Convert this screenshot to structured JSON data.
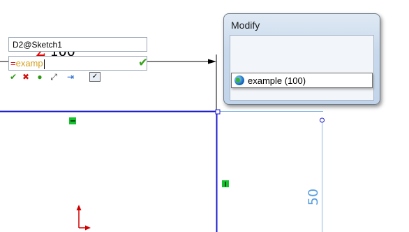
{
  "sketch": {
    "dimension_label": {
      "symbol": "Σ",
      "value": "100"
    },
    "vertical_dimension": "50",
    "colors": {
      "sketch_line": "#1c1ccc",
      "dimension_line": "#000000",
      "extension_line": "#5a9fe0",
      "relation": "#14c22e",
      "origin": "#d00000"
    },
    "icons": [
      "horizontal-relation-icon",
      "vertical-relation-icon",
      "origin-arrow-icon"
    ]
  },
  "modify_dialog": {
    "title": "Modify",
    "dimension_name": "D2@Sketch1",
    "value_prefix": "=",
    "value_text": "examp",
    "ok_icon": "check-icon",
    "toolbar_icons": [
      "confirm-icon",
      "cancel-icon",
      "rebuild-icon",
      "reverse-icon",
      "mark-icon",
      "toggle-icon"
    ]
  },
  "autocomplete": {
    "items": [
      {
        "icon": "globe-icon",
        "label": "example (100)"
      }
    ]
  }
}
